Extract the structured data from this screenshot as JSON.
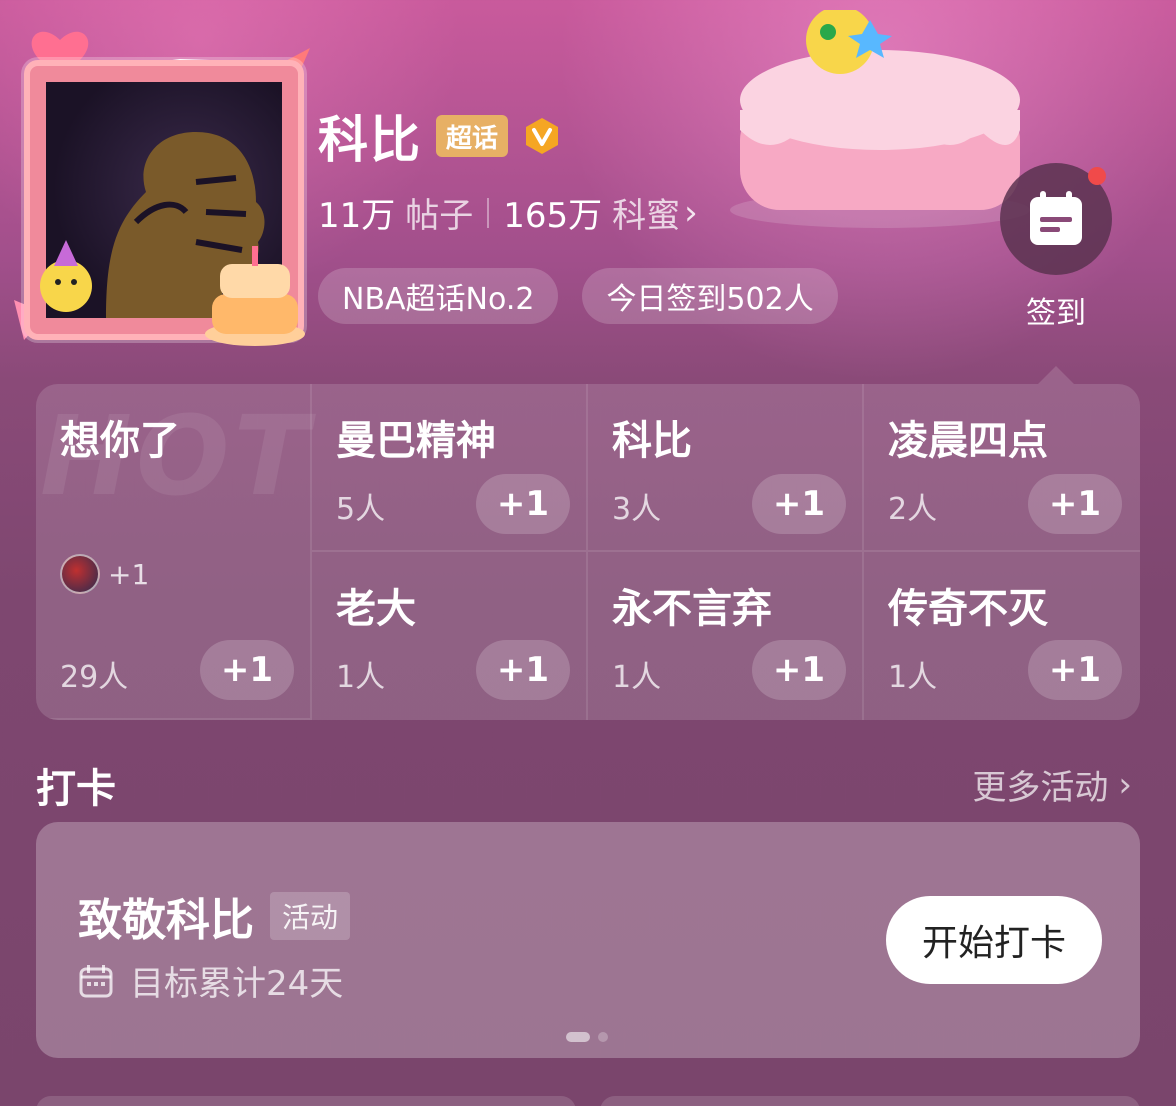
{
  "header": {
    "title": "科比",
    "super_badge": "超话",
    "posts_count": "11万",
    "posts_label": "帖子",
    "fans_count": "165万",
    "fans_label": "科蜜",
    "tags": [
      "NBA超话No.2",
      "今日签到502人"
    ],
    "checkin_label": "签到"
  },
  "grid": {
    "watermark": "HOT",
    "cells": [
      {
        "title": "想你了",
        "count": "29人",
        "plus": "+1",
        "avatar_plus": "+1"
      },
      {
        "title": "曼巴精神",
        "count": "5人",
        "plus": "+1"
      },
      {
        "title": "科比",
        "count": "3人",
        "plus": "+1"
      },
      {
        "title": "凌晨四点",
        "count": "2人",
        "plus": "+1"
      },
      {
        "title": "老大",
        "count": "1人",
        "plus": "+1"
      },
      {
        "title": "永不言弃",
        "count": "1人",
        "plus": "+1"
      },
      {
        "title": "传奇不灭",
        "count": "1人",
        "plus": "+1"
      }
    ]
  },
  "punch": {
    "section_title": "打卡",
    "more_label": "更多活动",
    "card_title": "致敬科比",
    "card_tag": "活动",
    "card_goal": "目标累计24天",
    "start_button": "开始打卡"
  },
  "colors": {
    "badge_gold": "#e7b065",
    "vip_orange": "#f5a623",
    "notify_red": "#f04a4a"
  }
}
